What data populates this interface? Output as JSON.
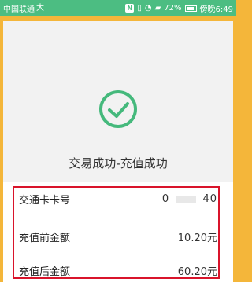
{
  "status_bar": {
    "carrier": "中国联通",
    "carrier_extra": "大",
    "nfc": "N",
    "battery_percent": "72%",
    "time": "傍晚6:49"
  },
  "result": {
    "title": "交易成功-充值成功",
    "icon": "check-circle-icon",
    "accent_color": "#45b97c"
  },
  "details": {
    "card_label": "交通卡卡号",
    "card_value_start": "0",
    "card_value_end": "40",
    "before_label": "充值前金额",
    "before_value": "10.20元",
    "after_label": "充值后金额",
    "after_value": "60.20元"
  },
  "annotation": {
    "highlight_color": "#d9142b"
  }
}
